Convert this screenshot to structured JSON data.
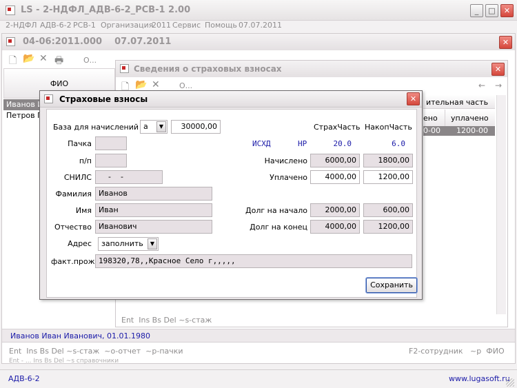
{
  "app": {
    "title": "LS - 2-НДФЛ_АДВ-6-2_РСВ-1  2.00",
    "menu": [
      "2-НДФЛ",
      "АДВ-6-2",
      "РСВ-1",
      "Организация",
      "2011",
      "Сервис",
      "Помощь",
      "07.07.2011"
    ],
    "minimize": "_",
    "maximize": "□",
    "close": "✕",
    "statusbar": {
      "left": "АДВ-6-2",
      "right": "www.lugasoft.ru"
    }
  },
  "window1": {
    "title": "04-06:2011.000    07.07.2011",
    "toolbar_more": "О...",
    "col_fio": "ФИО",
    "rows": [
      "Иванов И",
      "Петров П"
    ],
    "person_info": "Иванов Иван Иванович, 01.01.1980",
    "hotkeys_left": "Ent  Ins Bs Del ~s-стаж  ~o-отчет  ~p-пачки",
    "hotkeys_right": "F2-сотрудник   ~p  ФИО",
    "hotkeys_bottom": "Ent - ... Ins Bs Del ~s справочники"
  },
  "window2": {
    "title": "Сведения о страховых взносах",
    "toolbar_more": "О...",
    "arrow_left": "←",
    "arrow_right": "→",
    "header_group": "ительная часть",
    "col_charged": "ено",
    "col_paid": "уплачено",
    "row": {
      "charged": "0-00",
      "paid": "1200-00"
    },
    "hotkeys": "Ent  Ins Bs Del ~s-стаж"
  },
  "dialog": {
    "title": "Страховые взносы",
    "base_label": "База для начислений",
    "base_code": "а",
    "base_value": "30000,00",
    "labels": {
      "pachka": "Пачка",
      "pp": "п/п",
      "snils": "СНИЛС",
      "familiya": "Фамилия",
      "imya": "Имя",
      "otchestvo": "Отчество",
      "adres": "Адрес",
      "fakt": "факт.прож"
    },
    "values": {
      "pachka": "",
      "pp": "",
      "snils": "    -    -",
      "familiya": "Иванов",
      "imya": "Иван",
      "otchestvo": "Иванович",
      "adres": "заполнить",
      "fakt": "198320,78,,Красное Село г,,,,,"
    },
    "col_strah": "СтрахЧасть",
    "col_nakop": "НакопЧасть",
    "isxd": "ИСХД",
    "np": "НР",
    "rate_strah": "20.0",
    "rate_nakop": "6.0",
    "rows": [
      {
        "label": "Начислено",
        "strah": "6000,00",
        "nakop": "1800,00"
      },
      {
        "label": "Уплачено",
        "strah": "4000,00",
        "nakop": "1200,00"
      },
      {
        "label": "Долг на начало",
        "strah": "2000,00",
        "nakop": "600,00"
      },
      {
        "label": "Долг на конец",
        "strah": "4000,00",
        "nakop": "1200,00"
      }
    ],
    "save_button": "Сохранить"
  }
}
